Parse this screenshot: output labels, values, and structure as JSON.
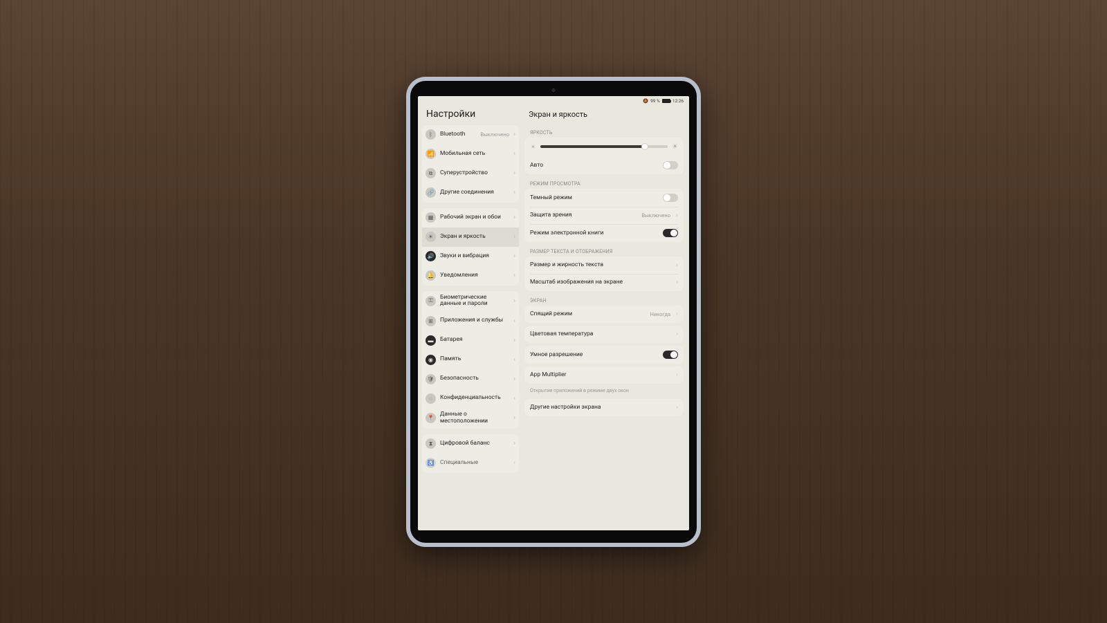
{
  "status": {
    "battery_text": "99 %",
    "time": "12:26"
  },
  "sidebar": {
    "title": "Настройки",
    "groups": [
      [
        {
          "icon": "bluetooth",
          "label": "Bluetooth",
          "value": "Выключено",
          "selected": false
        },
        {
          "icon": "antenna",
          "label": "Мобильная сеть"
        },
        {
          "icon": "device",
          "label": "Суперустройство"
        },
        {
          "icon": "link",
          "label": "Другие соединения"
        }
      ],
      [
        {
          "icon": "home",
          "label": "Рабочий экран и обои"
        },
        {
          "icon": "sun",
          "label": "Экран и яркость",
          "selected": true
        },
        {
          "icon": "sound",
          "label": "Звуки и вибрация",
          "iconDark": true
        },
        {
          "icon": "bell",
          "label": "Уведомления"
        }
      ],
      [
        {
          "icon": "key",
          "label": "Биометрические данные и пароли"
        },
        {
          "icon": "apps",
          "label": "Приложения и службы"
        },
        {
          "icon": "battery",
          "label": "Батарея",
          "iconDark": true
        },
        {
          "icon": "storage",
          "label": "Память",
          "iconDark": true
        },
        {
          "icon": "shield",
          "label": "Безопасность"
        },
        {
          "icon": "privacy",
          "label": "Конфиденциальность"
        },
        {
          "icon": "location",
          "label": "Данные о местоположении"
        }
      ],
      [
        {
          "icon": "balance",
          "label": "Цифровой баланс"
        },
        {
          "icon": "access",
          "label": "Специальные",
          "partial": true
        }
      ]
    ]
  },
  "detail": {
    "title": "Экран и яркость",
    "sections": {
      "brightness": {
        "label": "ЯРКОСТЬ",
        "slider_value": 82,
        "auto_label": "Авто",
        "auto_on": false
      },
      "view_mode": {
        "label": "РЕЖИМ ПРОСМОТРА",
        "rows": [
          {
            "label": "Темный режим",
            "type": "toggle",
            "on": false
          },
          {
            "label": "Защита зрения",
            "type": "link",
            "value": "Выключено"
          },
          {
            "label": "Режим электронной книги",
            "type": "toggle",
            "on": true
          }
        ]
      },
      "text_size": {
        "label": "РАЗМЕР ТЕКСТА И ОТОБРАЖЕНИЯ",
        "rows": [
          {
            "label": "Размер и жирность текста",
            "type": "link"
          },
          {
            "label": "Масштаб изображения на экране",
            "type": "link"
          }
        ]
      },
      "screen": {
        "label": "ЭКРАН",
        "rows": [
          {
            "label": "Спящий режим",
            "type": "link",
            "value": "Никогда"
          }
        ]
      },
      "color_temp": {
        "label": "Цветовая температура"
      },
      "smart_res": {
        "label": "Умное разрешение",
        "on": true
      },
      "app_mult": {
        "label": "App Multiplier",
        "footnote": "Открытие приложений в режиме двух окон"
      },
      "other": {
        "label": "Другие настройки экрана"
      }
    }
  }
}
